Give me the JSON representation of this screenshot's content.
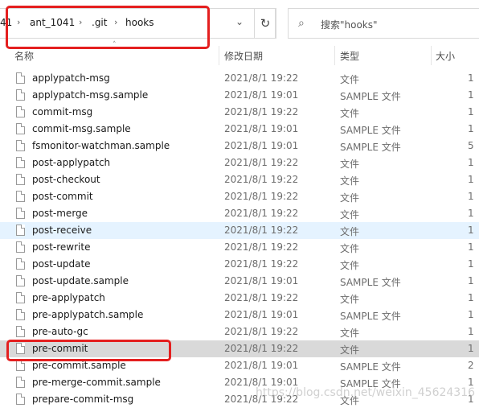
{
  "breadcrumb": {
    "partial": "41",
    "items": [
      "ant_1041",
      ".git",
      "hooks"
    ],
    "separator": "›"
  },
  "search": {
    "placeholder": "搜索\"hooks\""
  },
  "columns": {
    "name": "名称",
    "date": "修改日期",
    "type": "类型",
    "size": "大小"
  },
  "files": [
    {
      "name": "applypatch-msg",
      "date": "2021/8/1 19:22",
      "type": "文件",
      "size": "1"
    },
    {
      "name": "applypatch-msg.sample",
      "date": "2021/8/1 19:01",
      "type": "SAMPLE 文件",
      "size": "1"
    },
    {
      "name": "commit-msg",
      "date": "2021/8/1 19:22",
      "type": "文件",
      "size": "1"
    },
    {
      "name": "commit-msg.sample",
      "date": "2021/8/1 19:01",
      "type": "SAMPLE 文件",
      "size": "1"
    },
    {
      "name": "fsmonitor-watchman.sample",
      "date": "2021/8/1 19:01",
      "type": "SAMPLE 文件",
      "size": "5"
    },
    {
      "name": "post-applypatch",
      "date": "2021/8/1 19:22",
      "type": "文件",
      "size": "1"
    },
    {
      "name": "post-checkout",
      "date": "2021/8/1 19:22",
      "type": "文件",
      "size": "1"
    },
    {
      "name": "post-commit",
      "date": "2021/8/1 19:22",
      "type": "文件",
      "size": "1"
    },
    {
      "name": "post-merge",
      "date": "2021/8/1 19:22",
      "type": "文件",
      "size": "1"
    },
    {
      "name": "post-receive",
      "date": "2021/8/1 19:22",
      "type": "文件",
      "size": "1"
    },
    {
      "name": "post-rewrite",
      "date": "2021/8/1 19:22",
      "type": "文件",
      "size": "1"
    },
    {
      "name": "post-update",
      "date": "2021/8/1 19:22",
      "type": "文件",
      "size": "1"
    },
    {
      "name": "post-update.sample",
      "date": "2021/8/1 19:01",
      "type": "SAMPLE 文件",
      "size": "1"
    },
    {
      "name": "pre-applypatch",
      "date": "2021/8/1 19:22",
      "type": "文件",
      "size": "1"
    },
    {
      "name": "pre-applypatch.sample",
      "date": "2021/8/1 19:01",
      "type": "SAMPLE 文件",
      "size": "1"
    },
    {
      "name": "pre-auto-gc",
      "date": "2021/8/1 19:22",
      "type": "文件",
      "size": "1"
    },
    {
      "name": "pre-commit",
      "date": "2021/8/1 19:22",
      "type": "文件",
      "size": "1"
    },
    {
      "name": "pre-commit.sample",
      "date": "2021/8/1 19:01",
      "type": "SAMPLE 文件",
      "size": "2"
    },
    {
      "name": "pre-merge-commit.sample",
      "date": "2021/8/1 19:01",
      "type": "SAMPLE 文件",
      "size": "1"
    },
    {
      "name": "prepare-commit-msg",
      "date": "2021/8/1 19:22",
      "type": "文件",
      "size": "1"
    }
  ],
  "hover_row": "post-receive",
  "selected_row": "pre-commit",
  "watermark": "https://blog.csdn.net/weixin_45624316",
  "colors": {
    "highlight_box": "#e41f1f",
    "selected_row": "#d9d9d9",
    "hover_row": "#e5f3ff"
  }
}
